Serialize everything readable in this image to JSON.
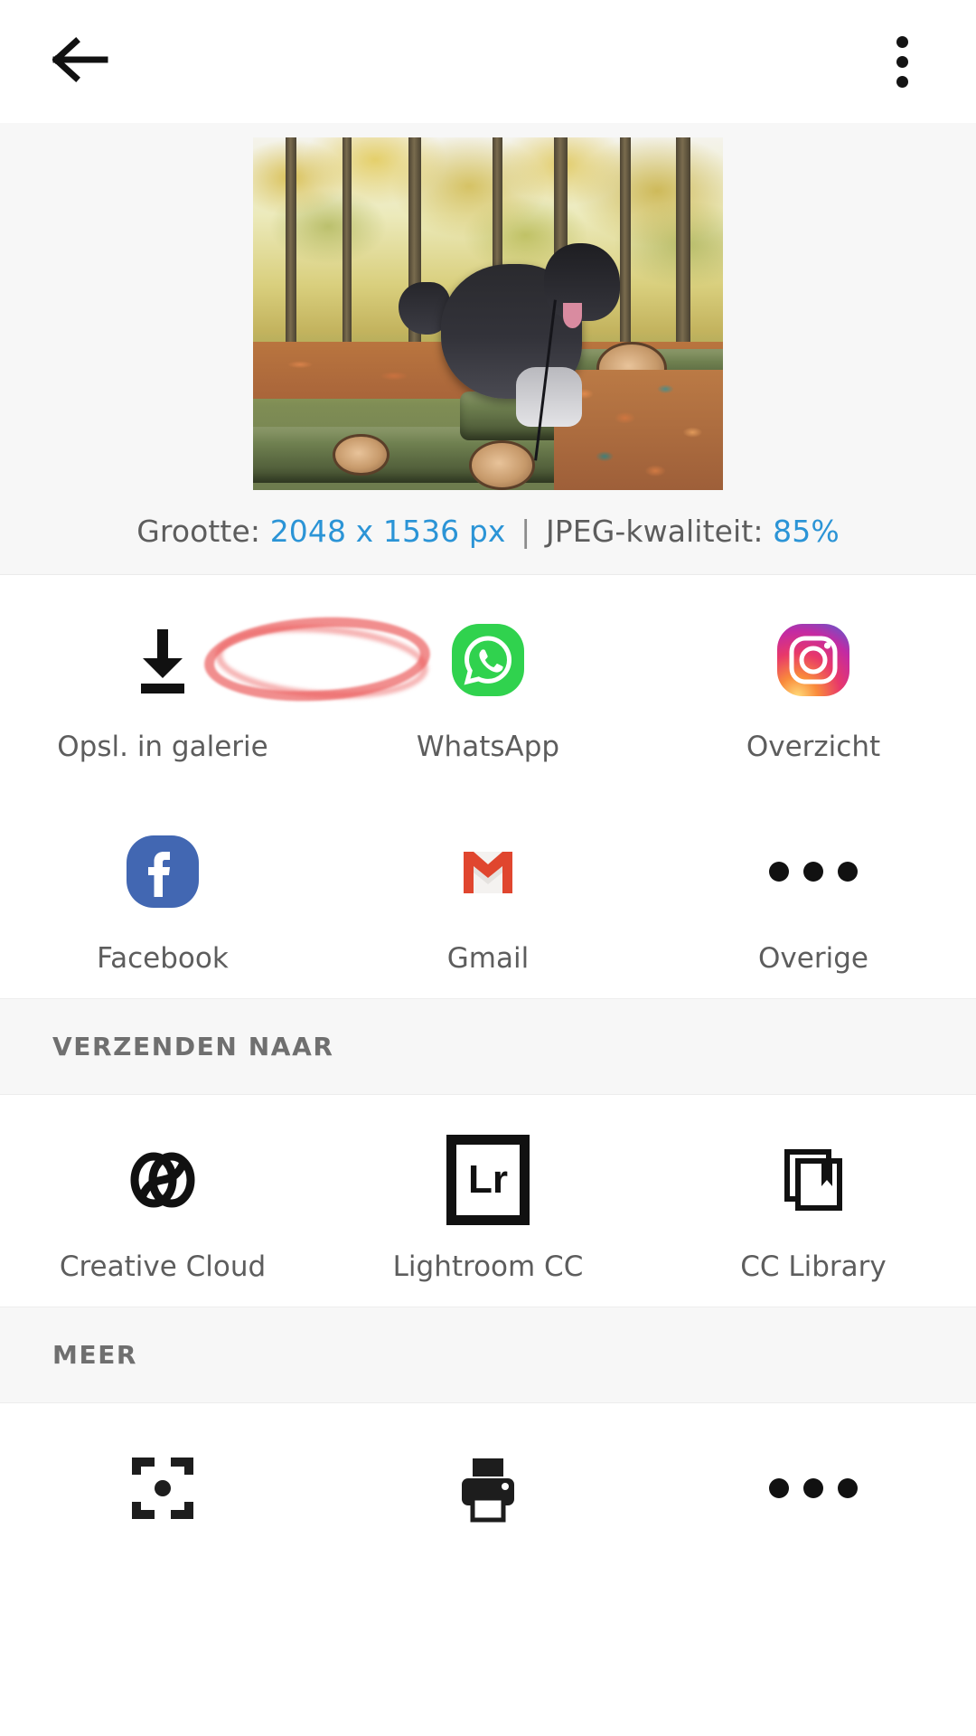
{
  "appbar": {
    "back_icon": "back-arrow-icon",
    "overflow_icon": "more-vertical-icon"
  },
  "preview": {
    "image_alt": "Zwarte langharige hond op boomstammen in herfstbos",
    "size_label": "Grootte:",
    "size_value": "2048 x 1536 px",
    "separator": "|",
    "quality_label": "JPEG-kwaliteit:",
    "quality_value": "85%",
    "accent_color": "#2b94d6",
    "label_color": "#5d5d5d",
    "annotation": {
      "type": "hand-drawn-ellipse",
      "color": "#e84848",
      "targets": "2048 x 1536 px"
    }
  },
  "share_grid": {
    "items": [
      {
        "label": "Opsl. in galerie",
        "icon": "download-icon"
      },
      {
        "label": "WhatsApp",
        "icon": "whatsapp-icon"
      },
      {
        "label": "Overzicht",
        "icon": "instagram-icon"
      },
      {
        "label": "Facebook",
        "icon": "facebook-icon"
      },
      {
        "label": "Gmail",
        "icon": "gmail-icon"
      },
      {
        "label": "Overige",
        "icon": "more-horizontal-icon"
      }
    ]
  },
  "send_to": {
    "heading": "VERZENDEN NAAR",
    "items": [
      {
        "label": "Creative Cloud",
        "icon": "adobe-creative-cloud-icon"
      },
      {
        "label": "Lightroom CC",
        "icon": "adobe-lightroom-icon",
        "glyph": "Lr"
      },
      {
        "label": "CC Library",
        "icon": "cc-library-icon"
      }
    ]
  },
  "more": {
    "heading": "MEER",
    "items": [
      {
        "label": "",
        "icon": "slideshow-icon"
      },
      {
        "label": "",
        "icon": "printer-icon"
      },
      {
        "label": "",
        "icon": "more-horizontal-icon"
      }
    ]
  }
}
